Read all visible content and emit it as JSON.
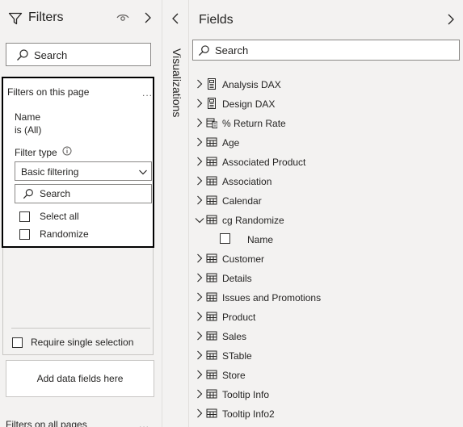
{
  "filters_pane": {
    "title": "Filters",
    "icons": {
      "title": "filter-funnel-icon",
      "visibility": "eye-icon",
      "collapse": "chevron-right-icon"
    },
    "search_placeholder": "Search",
    "on_this_page": {
      "label": "Filters on this page",
      "more": "...",
      "card": {
        "field_name": "Name",
        "state": "is (All)",
        "filter_type_label": "Filter type",
        "filter_type_value": "Basic filtering",
        "search_placeholder": "Search",
        "options": [
          "Select all",
          "Randomize"
        ],
        "require_single": "Require single selection"
      }
    },
    "add_fields": "Add data fields here",
    "on_all_pages": {
      "label": "Filters on all pages",
      "more": "..."
    }
  },
  "visualizations": {
    "label": "Visualizations"
  },
  "fields_pane": {
    "title": "Fields",
    "search_placeholder": "Search",
    "tables": [
      {
        "name": "Analysis DAX",
        "icon": "calculator-icon",
        "expanded": false
      },
      {
        "name": "Design DAX",
        "icon": "calculator-icon",
        "expanded": false
      },
      {
        "name": "% Return Rate",
        "icon": "measure-table-icon",
        "expanded": false
      },
      {
        "name": "Age",
        "icon": "table-icon",
        "expanded": false
      },
      {
        "name": "Associated Product",
        "icon": "table-icon",
        "expanded": false
      },
      {
        "name": "Association",
        "icon": "table-icon",
        "expanded": false
      },
      {
        "name": "Calendar",
        "icon": "table-icon",
        "expanded": false
      },
      {
        "name": "cg Randomize",
        "icon": "table-icon",
        "expanded": true,
        "fields": [
          "Name"
        ]
      },
      {
        "name": "Customer",
        "icon": "table-icon",
        "expanded": false
      },
      {
        "name": "Details",
        "icon": "table-icon",
        "expanded": false
      },
      {
        "name": "Issues and Promotions",
        "icon": "table-icon",
        "expanded": false
      },
      {
        "name": "Product",
        "icon": "table-icon",
        "expanded": false
      },
      {
        "name": "Sales",
        "icon": "table-icon",
        "expanded": false
      },
      {
        "name": "STable",
        "icon": "table-icon",
        "expanded": false
      },
      {
        "name": "Store",
        "icon": "table-icon",
        "expanded": false
      },
      {
        "name": "Tooltip Info",
        "icon": "table-icon",
        "expanded": false
      },
      {
        "name": "Tooltip Info2",
        "icon": "table-icon",
        "expanded": false
      }
    ]
  }
}
